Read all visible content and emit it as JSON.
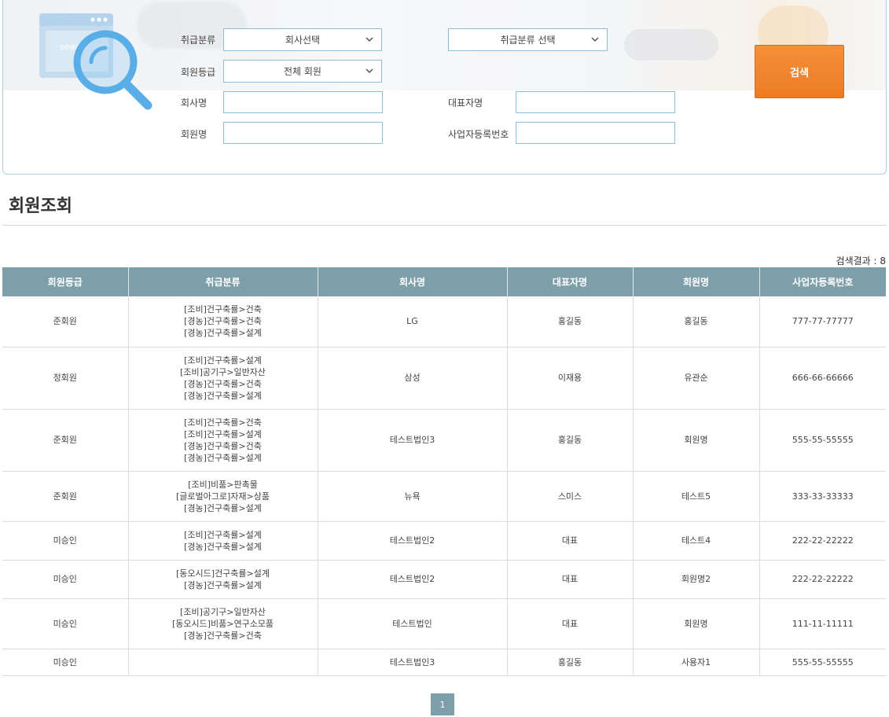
{
  "search": {
    "illustration_text": "sear",
    "category_label": "취급분류",
    "company_select": "회사선택",
    "category_select": "취급분류 선택",
    "grade_label": "회원등급",
    "grade_select": "전체 회원",
    "company_name_label": "회사명",
    "company_name_value": "",
    "ceo_label": "대표자명",
    "ceo_value": "",
    "member_name_label": "회원명",
    "member_name_value": "",
    "biz_no_label": "사업자등록번호",
    "biz_no_value": "",
    "search_button": "검색",
    "accent_color": "#f08530",
    "border_color": "#8fbfd8"
  },
  "page_title": "회원조회",
  "result_count": "검색결과 : 8",
  "table": {
    "headers": [
      "회원등급",
      "취급분류",
      "회사명",
      "대표자명",
      "회원명",
      "사업자등록번호"
    ],
    "header_color": "#7c9faa",
    "rows": [
      {
        "grade": "준회원",
        "categories": [
          "[조비]건구축률>건축",
          "[경농]건구축률>건축",
          "[경농]건구축률>설계"
        ],
        "company": "LG",
        "ceo": "홍길동",
        "member": "홍길동",
        "biz_no": "777-77-77777"
      },
      {
        "grade": "정회원",
        "categories": [
          "[조비]건구축률>설계",
          "[조비]공기구>일반자산",
          "[경농]건구축률>건축",
          "[경농]건구축률>설계"
        ],
        "company": "삼성",
        "ceo": "이재용",
        "member": "유관순",
        "biz_no": "666-66-66666"
      },
      {
        "grade": "준회원",
        "categories": [
          "[조비]건구축률>건축",
          "[조비]건구축률>설계",
          "[경농]건구축률>건축",
          "[경농]건구축률>설계"
        ],
        "company": "테스트법인3",
        "ceo": "홍길동",
        "member": "회원명",
        "biz_no": "555-55-55555"
      },
      {
        "grade": "준회원",
        "categories": [
          "[조비]비품>판촉물",
          "[글로벌아그로]자재>상품",
          "[경농]건구축률>설계"
        ],
        "company": "뉴욕",
        "ceo": "스미스",
        "member": "테스트5",
        "biz_no": "333-33-33333"
      },
      {
        "grade": "미승인",
        "categories": [
          "[조비]건구축률>설계",
          "[경농]건구축률>설계"
        ],
        "company": "테스트법인2",
        "ceo": "대표",
        "member": "테스트4",
        "biz_no": "222-22-22222"
      },
      {
        "grade": "미승인",
        "categories": [
          "[동오시드]건구축률>설계",
          "[경농]건구축률>설계"
        ],
        "company": "테스트법인2",
        "ceo": "대표",
        "member": "회원명2",
        "biz_no": "222-22-22222"
      },
      {
        "grade": "미승인",
        "categories": [
          "[조비]공기구>일반자산",
          "[동오시드]비품>연구소모품",
          "[경농]건구축률>건축"
        ],
        "company": "테스트법인",
        "ceo": "대표",
        "member": "회원명",
        "biz_no": "111-11-11111"
      },
      {
        "grade": "미승인",
        "categories": [],
        "company": "테스트법인3",
        "ceo": "홍길동",
        "member": "사용자1",
        "biz_no": "555-55-55555"
      }
    ]
  },
  "pagination": {
    "current_page": "1"
  }
}
